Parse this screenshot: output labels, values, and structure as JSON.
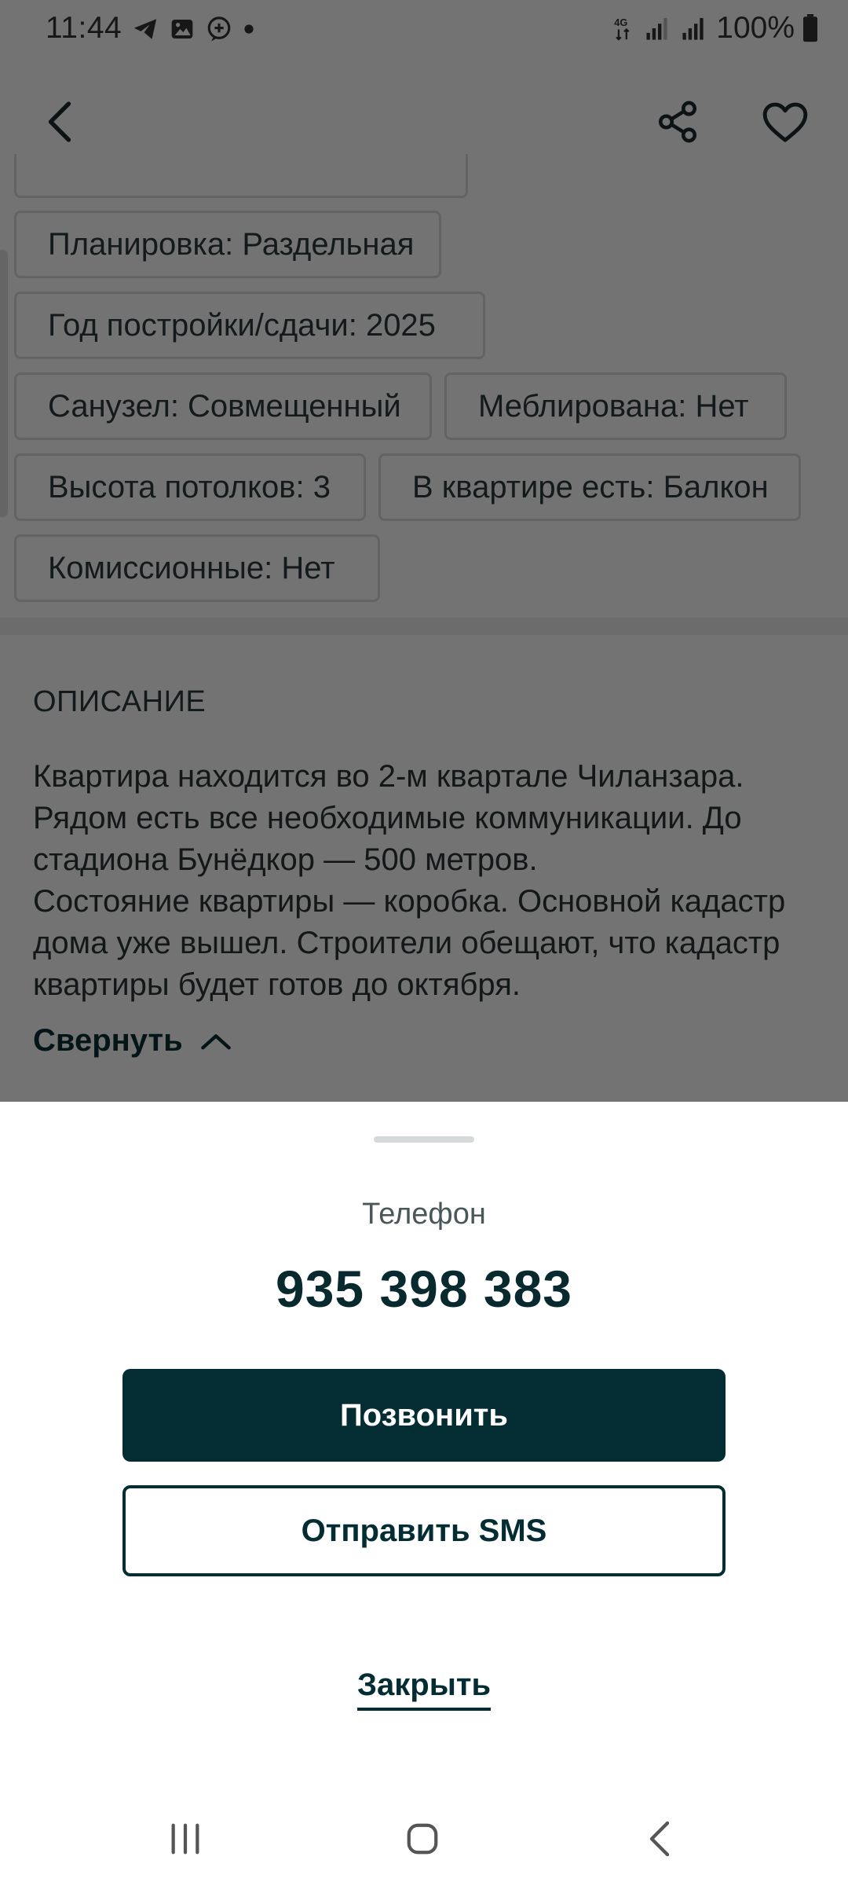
{
  "status_bar": {
    "time": "11:44",
    "left_icons": [
      "telegram-icon",
      "gallery-icon",
      "chat-plus-icon",
      "dot-icon"
    ],
    "network": "4G",
    "battery": "100%"
  },
  "top_bar": {
    "icons": [
      "back-arrow-icon",
      "share-icon",
      "heart-icon"
    ]
  },
  "properties": {
    "chips": [
      "Планировка: Раздельная",
      "Год постройки/сдачи: 2025",
      "Санузел: Совмещенный",
      "Меблирована: Нет",
      "Высота потолков: 3",
      "В квартире есть: Балкон",
      "Комиссионные: Нет"
    ]
  },
  "description": {
    "heading": "ОПИСАНИЕ",
    "lines": [
      "Квартира находится во 2-м квартале Чиланзара.",
      "Рядом есть все необходимые коммуникации. До",
      "стадиона Бунёдкор — 500 метров.",
      "Состояние квартиры — коробка. Основной кадастр",
      "дома уже вышел. Строители обещают, что кадастр",
      "квартиры будет готов до октября."
    ],
    "collapse_label": "Свернуть"
  },
  "sheet": {
    "phone_label": "Телефон",
    "phone_number": "935 398 383",
    "call_label": "Позвонить",
    "sms_label": "Отправить SMS",
    "close_label": "Закрыть"
  },
  "nav_bar": {
    "icons": [
      "recent-apps-icon",
      "home-icon",
      "back-icon"
    ]
  },
  "colors": {
    "accent": "#032d33",
    "overlay": "rgba(0,0,0,0.55)",
    "chip_border": "#dcdcdc"
  }
}
